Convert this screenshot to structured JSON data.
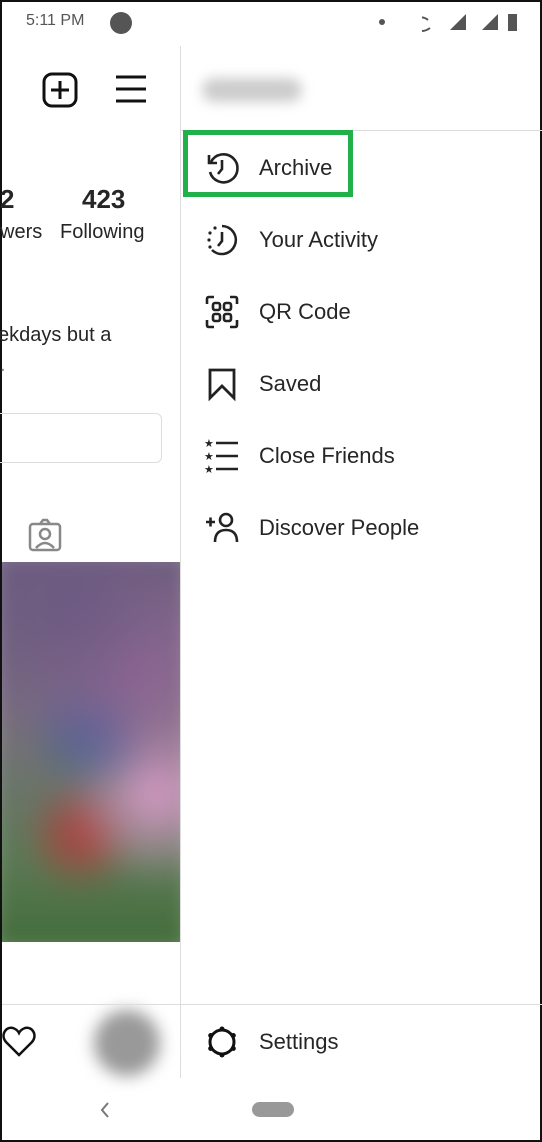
{
  "status_bar": {
    "time": "5:11 PM"
  },
  "profile": {
    "followers_count_partial": "2",
    "followers_label_partial": "wers",
    "following_count": "423",
    "following_label": "Following",
    "bio_line1": "ekdays but a",
    "bio_line2": "."
  },
  "menu": {
    "items": [
      {
        "label": "Archive",
        "icon": "archive-clock-icon",
        "highlighted": true
      },
      {
        "label": "Your Activity",
        "icon": "activity-clock-icon"
      },
      {
        "label": "QR Code",
        "icon": "qr-code-icon"
      },
      {
        "label": "Saved",
        "icon": "bookmark-icon"
      },
      {
        "label": "Close Friends",
        "icon": "star-list-icon"
      },
      {
        "label": "Discover People",
        "icon": "add-person-icon"
      }
    ],
    "settings_label": "Settings"
  },
  "colors": {
    "highlight": "#22b04b",
    "text": "#262626"
  }
}
